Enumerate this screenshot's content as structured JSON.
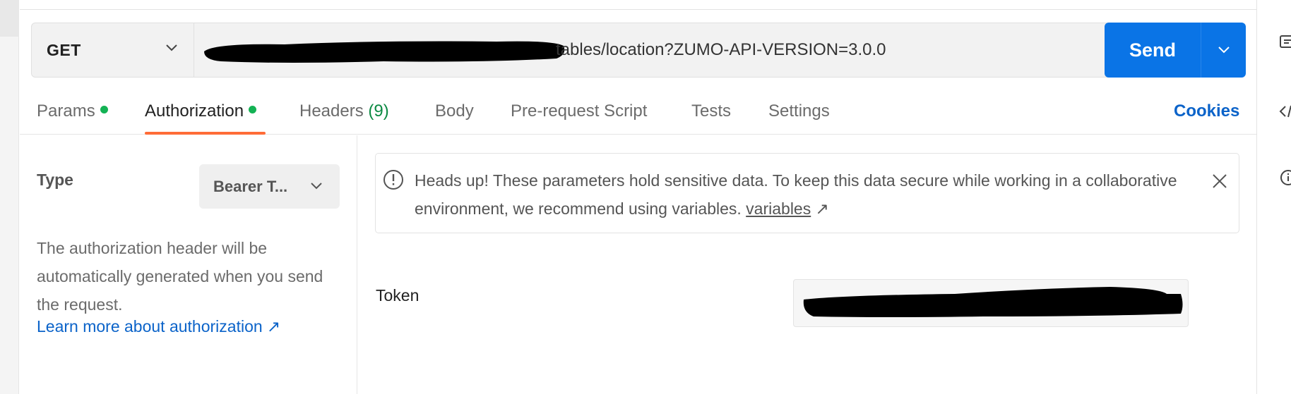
{
  "request": {
    "method": "GET",
    "url_visible": "tables/location?ZUMO-API-VERSION=3.0.0",
    "send_label": "Send"
  },
  "tabs": [
    {
      "label": "Params",
      "dot": true,
      "active": false
    },
    {
      "label": "Authorization",
      "dot": true,
      "active": true
    },
    {
      "label": "Headers",
      "count": "(9)",
      "active": false
    },
    {
      "label": "Body",
      "active": false
    },
    {
      "label": "Pre-request Script",
      "active": false
    },
    {
      "label": "Tests",
      "active": false
    },
    {
      "label": "Settings",
      "active": false
    }
  ],
  "cookies_label": "Cookies",
  "auth": {
    "type_label": "Type",
    "type_value": "Bearer T...",
    "help_text": "The authorization header will be automatically generated when you send the request.",
    "learn_more": "Learn more about authorization ↗"
  },
  "notice": {
    "text": "Heads up! These parameters hold sensitive data. To keep this data secure while working in a collaborative environment, we recommend using variables.",
    "link": "variables",
    "link_arrow": "↗"
  },
  "token": {
    "label": "Token"
  },
  "right_rail_icons": [
    "comment-icon",
    "code-icon",
    "info-icon"
  ],
  "colors": {
    "accent_send": "#0a74e6",
    "active_tab_underline": "#ff6c37",
    "status_dot": "#13b254",
    "link": "#0b63c9"
  }
}
